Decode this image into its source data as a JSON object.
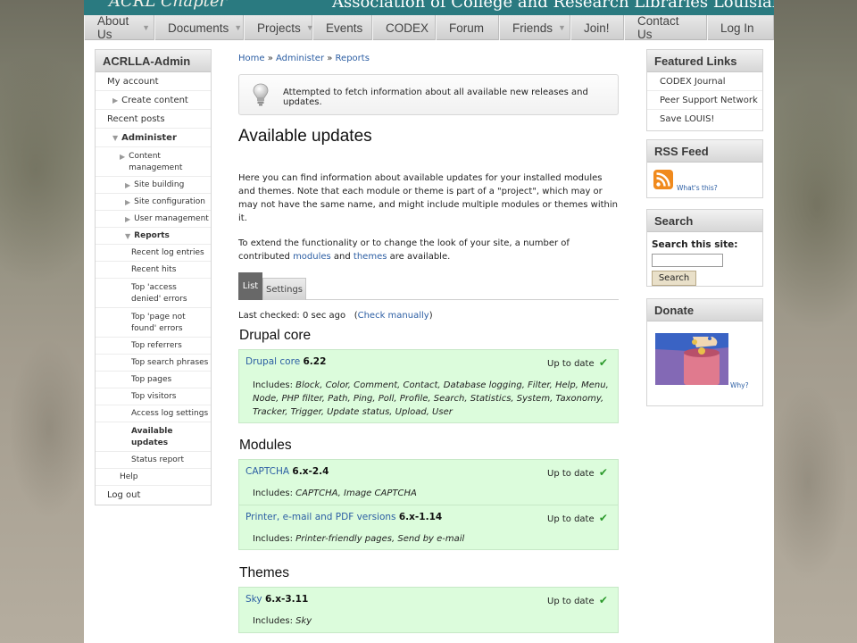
{
  "header": {
    "logo_text": "ACRL Chapter",
    "org_name": "Association of College and Research Libraries Louisiana Chapter"
  },
  "nav": [
    {
      "label": "About Us",
      "dropdown": true
    },
    {
      "label": "Documents",
      "dropdown": true
    },
    {
      "label": "Projects",
      "dropdown": true
    },
    {
      "label": "Events",
      "dropdown": false
    },
    {
      "label": "CODEX",
      "dropdown": false
    },
    {
      "label": "Forum",
      "dropdown": false
    },
    {
      "label": "Friends",
      "dropdown": true
    },
    {
      "label": "Join!",
      "dropdown": false
    },
    {
      "label": "Contact Us",
      "dropdown": false
    },
    {
      "label": "Log In",
      "dropdown": false
    }
  ],
  "left_sidebar": {
    "title": "ACRLLA-Admin",
    "items": [
      {
        "label": "My account"
      },
      {
        "label": "Create content"
      },
      {
        "label": "Recent posts"
      },
      {
        "label": "Administer"
      },
      {
        "label": "Content management"
      },
      {
        "label": "Site building"
      },
      {
        "label": "Site configuration"
      },
      {
        "label": "User management"
      },
      {
        "label": "Reports"
      },
      {
        "label": "Recent log entries"
      },
      {
        "label": "Recent hits"
      },
      {
        "label": "Top 'access denied' errors"
      },
      {
        "label": "Top 'page not found' errors"
      },
      {
        "label": "Top referrers"
      },
      {
        "label": "Top search phrases"
      },
      {
        "label": "Top pages"
      },
      {
        "label": "Top visitors"
      },
      {
        "label": "Access log settings"
      },
      {
        "label": "Available updates"
      },
      {
        "label": "Status report"
      },
      {
        "label": "Help"
      },
      {
        "label": "Log out"
      }
    ]
  },
  "breadcrumb": {
    "home": "Home",
    "sep1": " » ",
    "administer": "Administer",
    "sep2": " » ",
    "reports": "Reports"
  },
  "message": "Attempted to fetch information about all available new releases and updates.",
  "page_title": "Available updates",
  "intro": {
    "p1": "Here you can find information about available updates for your installed modules and themes. Note that each module or theme is part of a \"project\", which may or may not have the same name, and might include multiple modules or themes within it.",
    "p2_before": "To extend the functionality or to change the look of your site, a number of contributed ",
    "modules_link": "modules",
    "p2_and": " and ",
    "themes_link": "themes",
    "p2_after": " are available."
  },
  "tabs": {
    "list": "List",
    "settings": "Settings"
  },
  "last_checked": {
    "text": "Last checked: 0 sec ago",
    "open": "(",
    "link": "Check manually",
    "close": ")"
  },
  "sections": {
    "core": {
      "title": "Drupal core",
      "projects": [
        {
          "name": "Drupal core",
          "version": "6.22",
          "status": "Up to date",
          "includes_label": "Includes: ",
          "includes": "Block, Color, Comment, Contact, Database logging, Filter, Help, Menu, Node, PHP filter, Path, Ping, Poll, Profile, Search, Statistics, System, Taxonomy, Tracker, Trigger, Update status, Upload, User"
        }
      ]
    },
    "modules": {
      "title": "Modules",
      "projects": [
        {
          "name": "CAPTCHA",
          "version": "6.x-2.4",
          "status": "Up to date",
          "includes_label": "Includes: ",
          "includes": "CAPTCHA, Image CAPTCHA"
        },
        {
          "name": "Printer, e-mail and PDF versions",
          "version": "6.x-1.14",
          "status": "Up to date",
          "includes_label": "Includes: ",
          "includes": "Printer-friendly pages, Send by e-mail"
        }
      ]
    },
    "themes": {
      "title": "Themes",
      "projects": [
        {
          "name": "Sky",
          "version": "6.x-3.11",
          "status": "Up to date",
          "includes_label": "Includes: ",
          "includes": "Sky"
        }
      ]
    }
  },
  "right_sidebar": {
    "featured": {
      "title": "Featured Links",
      "links": [
        "CODEX Journal",
        "Peer Support Network",
        "Save LOUIS!"
      ]
    },
    "rss": {
      "title": "RSS Feed",
      "whats_this": "What's this?"
    },
    "search": {
      "title": "Search",
      "label": "Search this site:",
      "value": "",
      "button": "Search"
    },
    "donate": {
      "title": "Donate",
      "why": "Why?"
    }
  },
  "colors": {
    "accent_teal": "#2a7a80",
    "link": "#2c5ea3",
    "status_ok_bg": "#dcfcdc",
    "check_green": "#2c9a2c"
  }
}
